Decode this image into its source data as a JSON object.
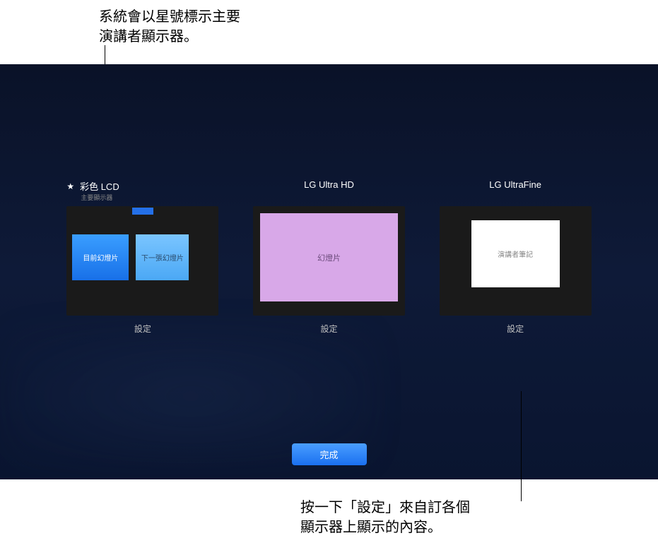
{
  "callouts": {
    "top": "系統會以星號標示主要\n演講者顯示器。",
    "bottom": "按一下「設定」來自訂各個\n顯示器上顯示的內容。"
  },
  "displays": [
    {
      "title": "彩色 LCD",
      "subtitle": "主要顯示器",
      "starred": true,
      "preview": {
        "current_label": "目前幻燈片",
        "next_label": "下一張幻燈片"
      },
      "settings_label": "設定"
    },
    {
      "title": "LG Ultra HD",
      "preview": {
        "slide_label": "幻燈片"
      },
      "settings_label": "設定"
    },
    {
      "title": "LG UltraFine",
      "preview": {
        "notes_label": "演講者筆記"
      },
      "settings_label": "設定"
    }
  ],
  "done_button": "完成"
}
